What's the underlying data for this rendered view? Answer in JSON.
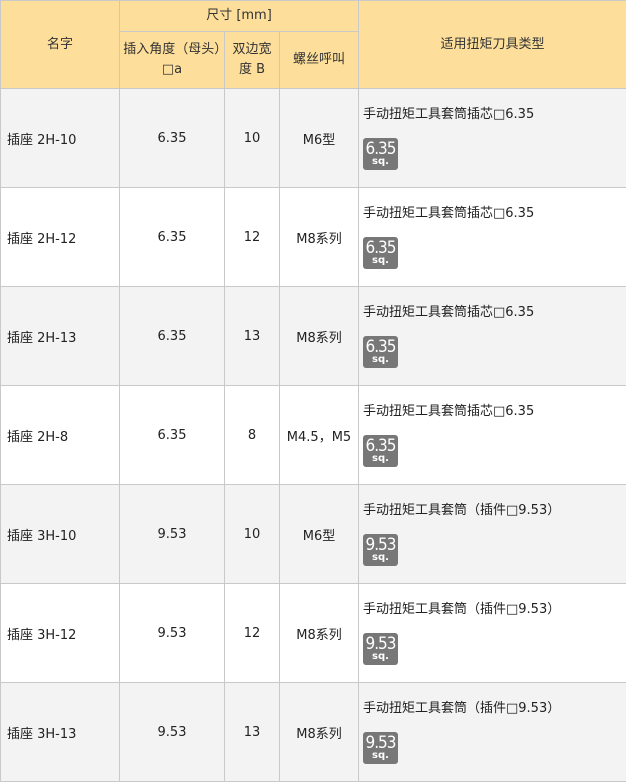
{
  "header": {
    "name": "名字",
    "size_group": "尺寸 [mm]",
    "insert_angle": "插入角度（母头）□a",
    "width_b": "双边宽度 B",
    "thread": "螺丝呼叫",
    "tool_type": "适用扭矩刀具类型"
  },
  "rows": [
    {
      "name": "插座 2H-10",
      "angle": "6.35",
      "width": "10",
      "thread": "M6型",
      "tool": "手动扭矩工具套筒插芯□6.35",
      "badge_num": "6.35",
      "badge_unit": "sq."
    },
    {
      "name": "插座 2H-12",
      "angle": "6.35",
      "width": "12",
      "thread": "M8系列",
      "tool": "手动扭矩工具套筒插芯□6.35",
      "badge_num": "6.35",
      "badge_unit": "sq."
    },
    {
      "name": "插座 2H-13",
      "angle": "6.35",
      "width": "13",
      "thread": "M8系列",
      "tool": "手动扭矩工具套筒插芯□6.35",
      "badge_num": "6.35",
      "badge_unit": "sq."
    },
    {
      "name": "插座 2H-8",
      "angle": "6.35",
      "width": "8",
      "thread": "M4.5，M5",
      "tool": "手动扭矩工具套筒插芯□6.35",
      "badge_num": "6.35",
      "badge_unit": "sq."
    },
    {
      "name": "插座 3H-10",
      "angle": "9.53",
      "width": "10",
      "thread": "M6型",
      "tool": "手动扭矩工具套筒（插件□9.53）",
      "badge_num": "9.53",
      "badge_unit": "sq."
    },
    {
      "name": "插座 3H-12",
      "angle": "9.53",
      "width": "12",
      "thread": "M8系列",
      "tool": "手动扭矩工具套筒（插件□9.53）",
      "badge_num": "9.53",
      "badge_unit": "sq."
    },
    {
      "name": "插座 3H-13",
      "angle": "9.53",
      "width": "13",
      "thread": "M8系列",
      "tool": "手动扭矩工具套筒（插件□9.53）",
      "badge_num": "9.53",
      "badge_unit": "sq."
    }
  ],
  "colors": {
    "header_bg": "#fddf9b",
    "alt_row_bg": "#f3f3f3",
    "badge_bg": "#777777",
    "border": "#c9c9c9"
  },
  "icons": {
    "badge": "square-drive-size-icon"
  }
}
